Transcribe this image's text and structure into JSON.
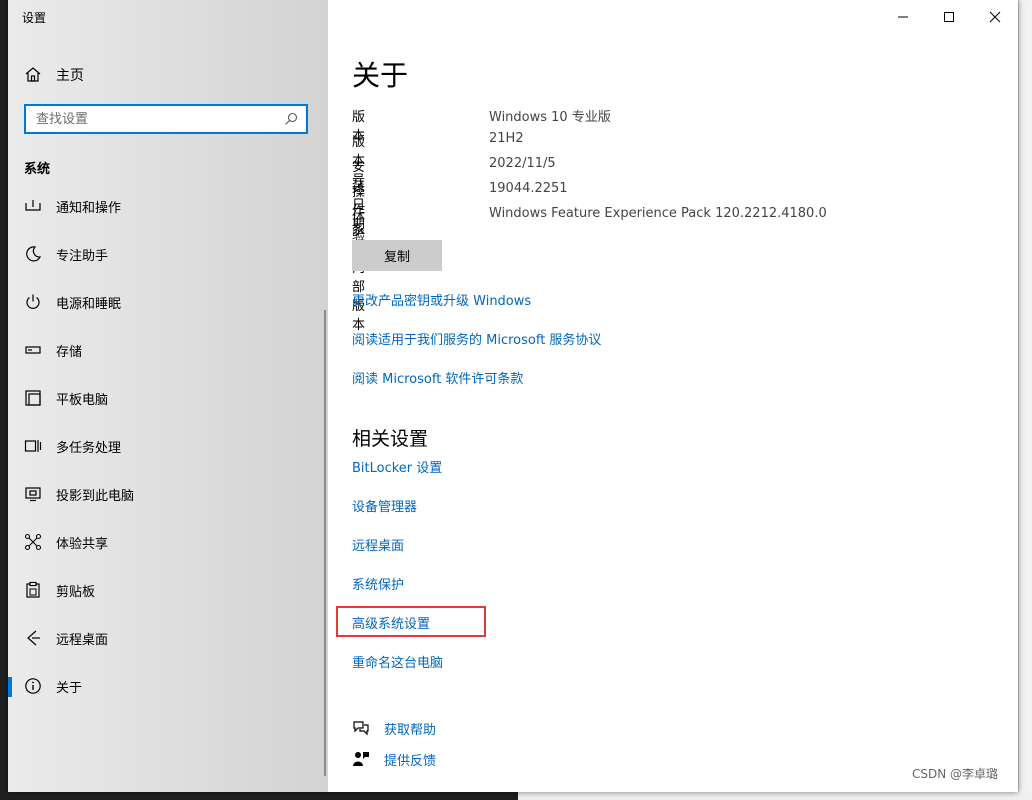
{
  "window": {
    "title": "设置"
  },
  "sidebar": {
    "home_label": "主页",
    "search": {
      "placeholder": "查找设置"
    },
    "section": "系统",
    "items": [
      {
        "label": "通知和操作",
        "icon": "notification-icon",
        "selected": false
      },
      {
        "label": "专注助手",
        "icon": "moon-icon",
        "selected": false
      },
      {
        "label": "电源和睡眠",
        "icon": "power-icon",
        "selected": false
      },
      {
        "label": "存储",
        "icon": "storage-icon",
        "selected": false
      },
      {
        "label": "平板电脑",
        "icon": "tablet-icon",
        "selected": false
      },
      {
        "label": "多任务处理",
        "icon": "multitask-icon",
        "selected": false
      },
      {
        "label": "投影到此电脑",
        "icon": "project-icon",
        "selected": false
      },
      {
        "label": "体验共享",
        "icon": "share-icon",
        "selected": false
      },
      {
        "label": "剪贴板",
        "icon": "clipboard-icon",
        "selected": false
      },
      {
        "label": "远程桌面",
        "icon": "remote-desktop-icon",
        "selected": false
      },
      {
        "label": "关于",
        "icon": "info-icon",
        "selected": true
      }
    ]
  },
  "content": {
    "title": "关于",
    "specs": [
      {
        "key": "版本",
        "value": "Windows 10 专业版"
      },
      {
        "key": "版本号",
        "value": "21H2"
      },
      {
        "key": "安装日期",
        "value": "2022/11/5"
      },
      {
        "key": "操作系统内部版本",
        "value": "19044.2251"
      },
      {
        "key": "体验",
        "value": "Windows Feature Experience Pack 120.2212.4180.0"
      }
    ],
    "copy_label": "复制",
    "links": [
      "更改产品密钥或升级 Windows",
      "阅读适用于我们服务的 Microsoft 服务协议",
      "阅读 Microsoft 软件许可条款"
    ],
    "related_title": "相关设置",
    "related_links": [
      "BitLocker 设置",
      "设备管理器",
      "远程桌面",
      "系统保护",
      "高级系统设置",
      "重命名这台电脑"
    ],
    "help": [
      {
        "label": "获取帮助",
        "icon": "help-chat-icon"
      },
      {
        "label": "提供反馈",
        "icon": "feedback-icon"
      }
    ]
  },
  "watermark": "CSDN @李卓璐",
  "colors": {
    "accent": "#0078d7",
    "link": "#0067c0",
    "highlight": "#e53935"
  }
}
